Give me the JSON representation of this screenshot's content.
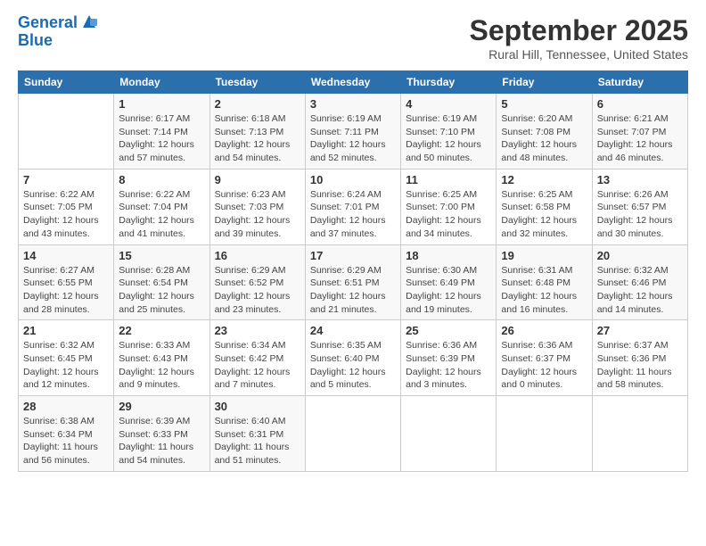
{
  "header": {
    "logo_line1": "General",
    "logo_line2": "Blue",
    "month_title": "September 2025",
    "location": "Rural Hill, Tennessee, United States"
  },
  "weekdays": [
    "Sunday",
    "Monday",
    "Tuesday",
    "Wednesday",
    "Thursday",
    "Friday",
    "Saturday"
  ],
  "weeks": [
    [
      {
        "day": "",
        "info": ""
      },
      {
        "day": "1",
        "info": "Sunrise: 6:17 AM\nSunset: 7:14 PM\nDaylight: 12 hours\nand 57 minutes."
      },
      {
        "day": "2",
        "info": "Sunrise: 6:18 AM\nSunset: 7:13 PM\nDaylight: 12 hours\nand 54 minutes."
      },
      {
        "day": "3",
        "info": "Sunrise: 6:19 AM\nSunset: 7:11 PM\nDaylight: 12 hours\nand 52 minutes."
      },
      {
        "day": "4",
        "info": "Sunrise: 6:19 AM\nSunset: 7:10 PM\nDaylight: 12 hours\nand 50 minutes."
      },
      {
        "day": "5",
        "info": "Sunrise: 6:20 AM\nSunset: 7:08 PM\nDaylight: 12 hours\nand 48 minutes."
      },
      {
        "day": "6",
        "info": "Sunrise: 6:21 AM\nSunset: 7:07 PM\nDaylight: 12 hours\nand 46 minutes."
      }
    ],
    [
      {
        "day": "7",
        "info": "Sunrise: 6:22 AM\nSunset: 7:05 PM\nDaylight: 12 hours\nand 43 minutes."
      },
      {
        "day": "8",
        "info": "Sunrise: 6:22 AM\nSunset: 7:04 PM\nDaylight: 12 hours\nand 41 minutes."
      },
      {
        "day": "9",
        "info": "Sunrise: 6:23 AM\nSunset: 7:03 PM\nDaylight: 12 hours\nand 39 minutes."
      },
      {
        "day": "10",
        "info": "Sunrise: 6:24 AM\nSunset: 7:01 PM\nDaylight: 12 hours\nand 37 minutes."
      },
      {
        "day": "11",
        "info": "Sunrise: 6:25 AM\nSunset: 7:00 PM\nDaylight: 12 hours\nand 34 minutes."
      },
      {
        "day": "12",
        "info": "Sunrise: 6:25 AM\nSunset: 6:58 PM\nDaylight: 12 hours\nand 32 minutes."
      },
      {
        "day": "13",
        "info": "Sunrise: 6:26 AM\nSunset: 6:57 PM\nDaylight: 12 hours\nand 30 minutes."
      }
    ],
    [
      {
        "day": "14",
        "info": "Sunrise: 6:27 AM\nSunset: 6:55 PM\nDaylight: 12 hours\nand 28 minutes."
      },
      {
        "day": "15",
        "info": "Sunrise: 6:28 AM\nSunset: 6:54 PM\nDaylight: 12 hours\nand 25 minutes."
      },
      {
        "day": "16",
        "info": "Sunrise: 6:29 AM\nSunset: 6:52 PM\nDaylight: 12 hours\nand 23 minutes."
      },
      {
        "day": "17",
        "info": "Sunrise: 6:29 AM\nSunset: 6:51 PM\nDaylight: 12 hours\nand 21 minutes."
      },
      {
        "day": "18",
        "info": "Sunrise: 6:30 AM\nSunset: 6:49 PM\nDaylight: 12 hours\nand 19 minutes."
      },
      {
        "day": "19",
        "info": "Sunrise: 6:31 AM\nSunset: 6:48 PM\nDaylight: 12 hours\nand 16 minutes."
      },
      {
        "day": "20",
        "info": "Sunrise: 6:32 AM\nSunset: 6:46 PM\nDaylight: 12 hours\nand 14 minutes."
      }
    ],
    [
      {
        "day": "21",
        "info": "Sunrise: 6:32 AM\nSunset: 6:45 PM\nDaylight: 12 hours\nand 12 minutes."
      },
      {
        "day": "22",
        "info": "Sunrise: 6:33 AM\nSunset: 6:43 PM\nDaylight: 12 hours\nand 9 minutes."
      },
      {
        "day": "23",
        "info": "Sunrise: 6:34 AM\nSunset: 6:42 PM\nDaylight: 12 hours\nand 7 minutes."
      },
      {
        "day": "24",
        "info": "Sunrise: 6:35 AM\nSunset: 6:40 PM\nDaylight: 12 hours\nand 5 minutes."
      },
      {
        "day": "25",
        "info": "Sunrise: 6:36 AM\nSunset: 6:39 PM\nDaylight: 12 hours\nand 3 minutes."
      },
      {
        "day": "26",
        "info": "Sunrise: 6:36 AM\nSunset: 6:37 PM\nDaylight: 12 hours\nand 0 minutes."
      },
      {
        "day": "27",
        "info": "Sunrise: 6:37 AM\nSunset: 6:36 PM\nDaylight: 11 hours\nand 58 minutes."
      }
    ],
    [
      {
        "day": "28",
        "info": "Sunrise: 6:38 AM\nSunset: 6:34 PM\nDaylight: 11 hours\nand 56 minutes."
      },
      {
        "day": "29",
        "info": "Sunrise: 6:39 AM\nSunset: 6:33 PM\nDaylight: 11 hours\nand 54 minutes."
      },
      {
        "day": "30",
        "info": "Sunrise: 6:40 AM\nSunset: 6:31 PM\nDaylight: 11 hours\nand 51 minutes."
      },
      {
        "day": "",
        "info": ""
      },
      {
        "day": "",
        "info": ""
      },
      {
        "day": "",
        "info": ""
      },
      {
        "day": "",
        "info": ""
      }
    ]
  ]
}
